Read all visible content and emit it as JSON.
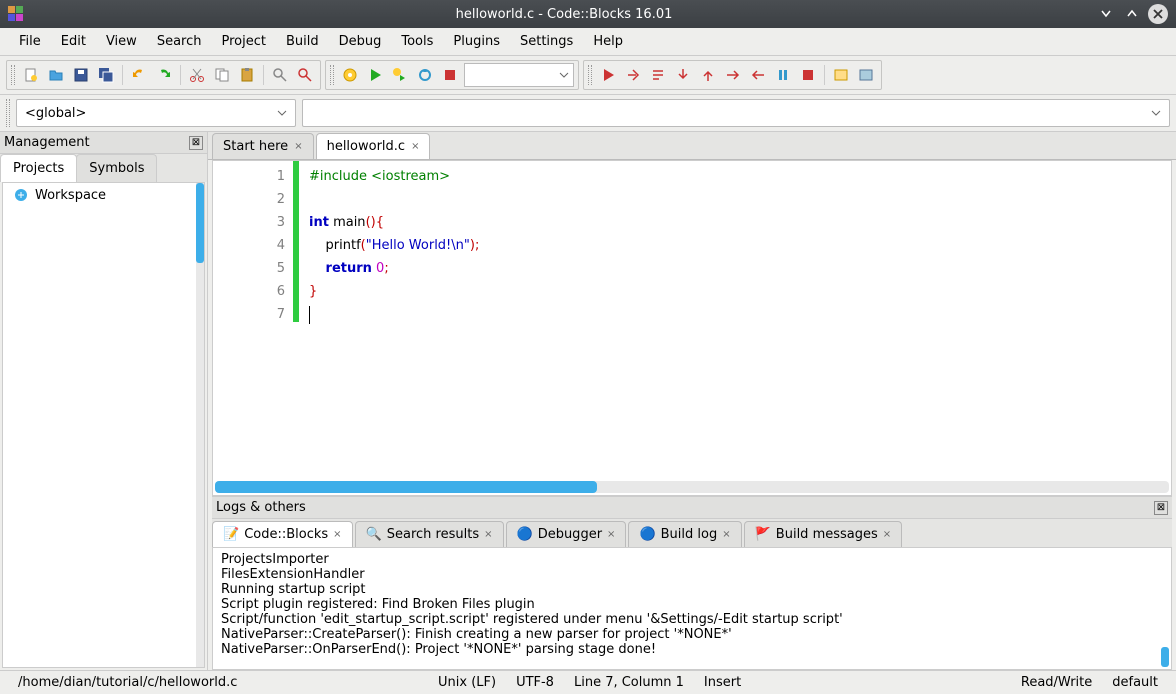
{
  "window": {
    "title": "helloworld.c - Code::Blocks 16.01"
  },
  "menu": [
    "File",
    "Edit",
    "View",
    "Search",
    "Project",
    "Build",
    "Debug",
    "Tools",
    "Plugins",
    "Settings",
    "Help"
  ],
  "scope": {
    "left": "<global>",
    "right": ""
  },
  "management": {
    "title": "Management",
    "tabs": [
      "Projects",
      "Symbols"
    ],
    "active_tab": 0,
    "tree": {
      "root_label": "Workspace"
    }
  },
  "editor": {
    "tabs": [
      {
        "label": "Start here",
        "active": false
      },
      {
        "label": "helloworld.c",
        "active": true
      }
    ],
    "code": {
      "lines": [
        {
          "n": 1,
          "tokens": [
            {
              "t": "#include <iostream>",
              "c": "kw-green"
            }
          ]
        },
        {
          "n": 2,
          "tokens": []
        },
        {
          "n": 3,
          "tokens": [
            {
              "t": "int",
              "c": "kw-blue"
            },
            {
              "t": " main"
            },
            {
              "t": "(){",
              "c": "punct-red"
            }
          ]
        },
        {
          "n": 4,
          "tokens": [
            {
              "t": "    printf"
            },
            {
              "t": "(",
              "c": "punct-red"
            },
            {
              "t": "\"Hello World!\\n\"",
              "c": "str"
            },
            {
              "t": ");",
              "c": "punct-red"
            }
          ]
        },
        {
          "n": 5,
          "tokens": [
            {
              "t": "    "
            },
            {
              "t": "return",
              "c": "kw-blue"
            },
            {
              "t": " "
            },
            {
              "t": "0",
              "c": "num"
            },
            {
              "t": ";",
              "c": "punct-red"
            }
          ]
        },
        {
          "n": 6,
          "tokens": [
            {
              "t": "}",
              "c": "punct-red"
            }
          ]
        },
        {
          "n": 7,
          "tokens": [],
          "cursor": true
        }
      ]
    }
  },
  "logs": {
    "title": "Logs & others",
    "tabs": [
      "Code::Blocks",
      "Search results",
      "Debugger",
      "Build log",
      "Build messages"
    ],
    "active_tab": 0,
    "lines": [
      "ProjectsImporter",
      "FilesExtensionHandler",
      "Running startup script",
      "Script plugin registered: Find Broken Files plugin",
      "Script/function 'edit_startup_script.script' registered under menu '&Settings/-Edit startup script'",
      "NativeParser::CreateParser(): Finish creating a new parser for project '*NONE*'",
      "NativeParser::OnParserEnd(): Project '*NONE*' parsing stage done!"
    ]
  },
  "status": {
    "path": "/home/dian/tutorial/c/helloworld.c",
    "eol": "Unix (LF)",
    "encoding": "UTF-8",
    "position": "Line 7, Column 1",
    "insert_mode": "Insert",
    "rw": "Read/Write",
    "profile": "default"
  }
}
